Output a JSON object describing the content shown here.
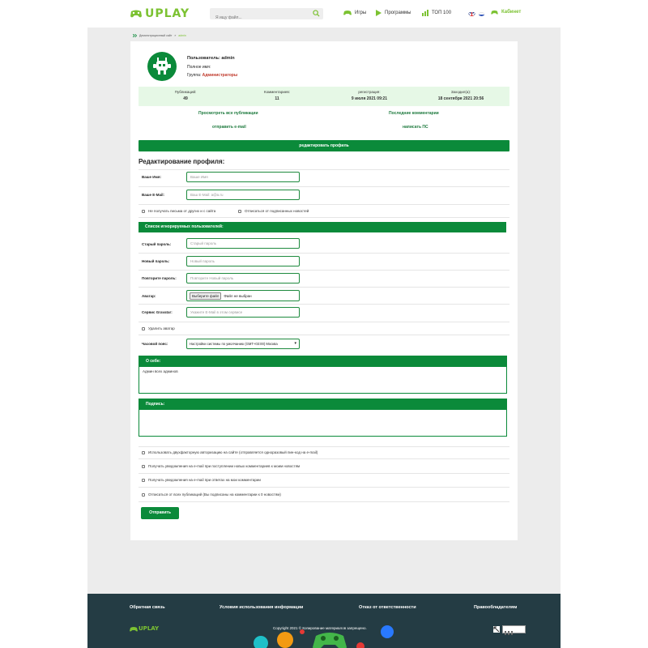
{
  "header": {
    "logo_text": "UPLAY",
    "search_placeholder": "Я ищу файл...",
    "nav": [
      {
        "label": "Игры",
        "icon": "gamepad-icon"
      },
      {
        "label": "Программы",
        "icon": "play-icon"
      },
      {
        "label": "ТОП 100",
        "icon": "bar-chart-icon"
      }
    ],
    "cabinet_label": "Кабинет",
    "accent_color": "#7cc232"
  },
  "breadcrumb": {
    "home": "Демонстрационный сайт",
    "sep": "»",
    "current": "admin"
  },
  "profile": {
    "user_label": "Пользователь: admin",
    "fullname_label": "Полное имя:",
    "group_prefix": "Группа:",
    "group_value": "Администраторы",
    "stats": [
      {
        "label": "Публикаций:",
        "value": "49"
      },
      {
        "label": "Комментариев:",
        "value": "11"
      },
      {
        "label": "регистрация:",
        "value": "9 июля 2021 09:21"
      },
      {
        "label": "Заходил(а):",
        "value": "18 сентября 2021 20:56"
      }
    ],
    "links": {
      "all_publications": "Просмотреть все публикации",
      "last_comments": "Последние комментарии",
      "send_email": "отправить e-mail",
      "send_pm": "написать ПС"
    },
    "edit_button": "редактировать профиль"
  },
  "form": {
    "title": "Редактирование профиля:",
    "name_label": "Ваше Имя:",
    "name_placeholder": "Ваше Имя",
    "email_label": "Ваше E-Mail:",
    "email_placeholder": "Ваш E-Mail: a@a.ru",
    "no_mail_label": "Не получать письма от других и с сайта",
    "unsubscribe_news_label": "Отписаться от подписанных новостей",
    "ignore_list_title": "Список игнорируемых пользователей:",
    "old_pass_label": "Старый пароль:",
    "old_pass_placeholder": "Старый пароль",
    "new_pass_label": "Новый пароль:",
    "new_pass_placeholder": "Новый пароль",
    "repeat_pass_label": "Повторите пароль:",
    "repeat_pass_placeholder": "Повторите Новый пароль",
    "avatar_label": "Аватар:",
    "file_button": "Выберите файл",
    "file_status": "Файл не выбран",
    "gravatar_label": "Сервис Gravatar:",
    "gravatar_placeholder": "Укажите E-Mail в этом сервисе",
    "delete_avatar_label": "Удалить аватар",
    "timezone_label": "Часовой пояс:",
    "timezone_value": "Настройки системы по умолчанию (GMT+03:00) Москва",
    "about_title": "О себе:",
    "about_value": "Админ  всех  админов",
    "signature_title": "Подпись:",
    "signature_value": "",
    "opt_twofactor": "Использовать двухфакторную авторизацию на сайте (отправляется одноразовый пин-код на e-mail)",
    "opt_notify_comments": "Получать уведомления на e-mail при поступлении новых комментариев к моим новостям",
    "opt_notify_replies": "Получать уведомления на e-mail при ответах на мои комментарии",
    "opt_unsubscribe_all": "Отписаться от всех публикаций (Вы подписаны на комментарии к 0 новостям)",
    "submit": "Отправить",
    "primary_color": "#0b8a3a"
  },
  "footer": {
    "links": [
      "Обратная связь",
      "Условия использования информации",
      "Отказ от ответственности",
      "Правообладателям"
    ],
    "logo_text": "UPLAY",
    "copyright": "Copyright 2021 © Копирование материалов запрещено.",
    "bg_color": "#243c44"
  }
}
